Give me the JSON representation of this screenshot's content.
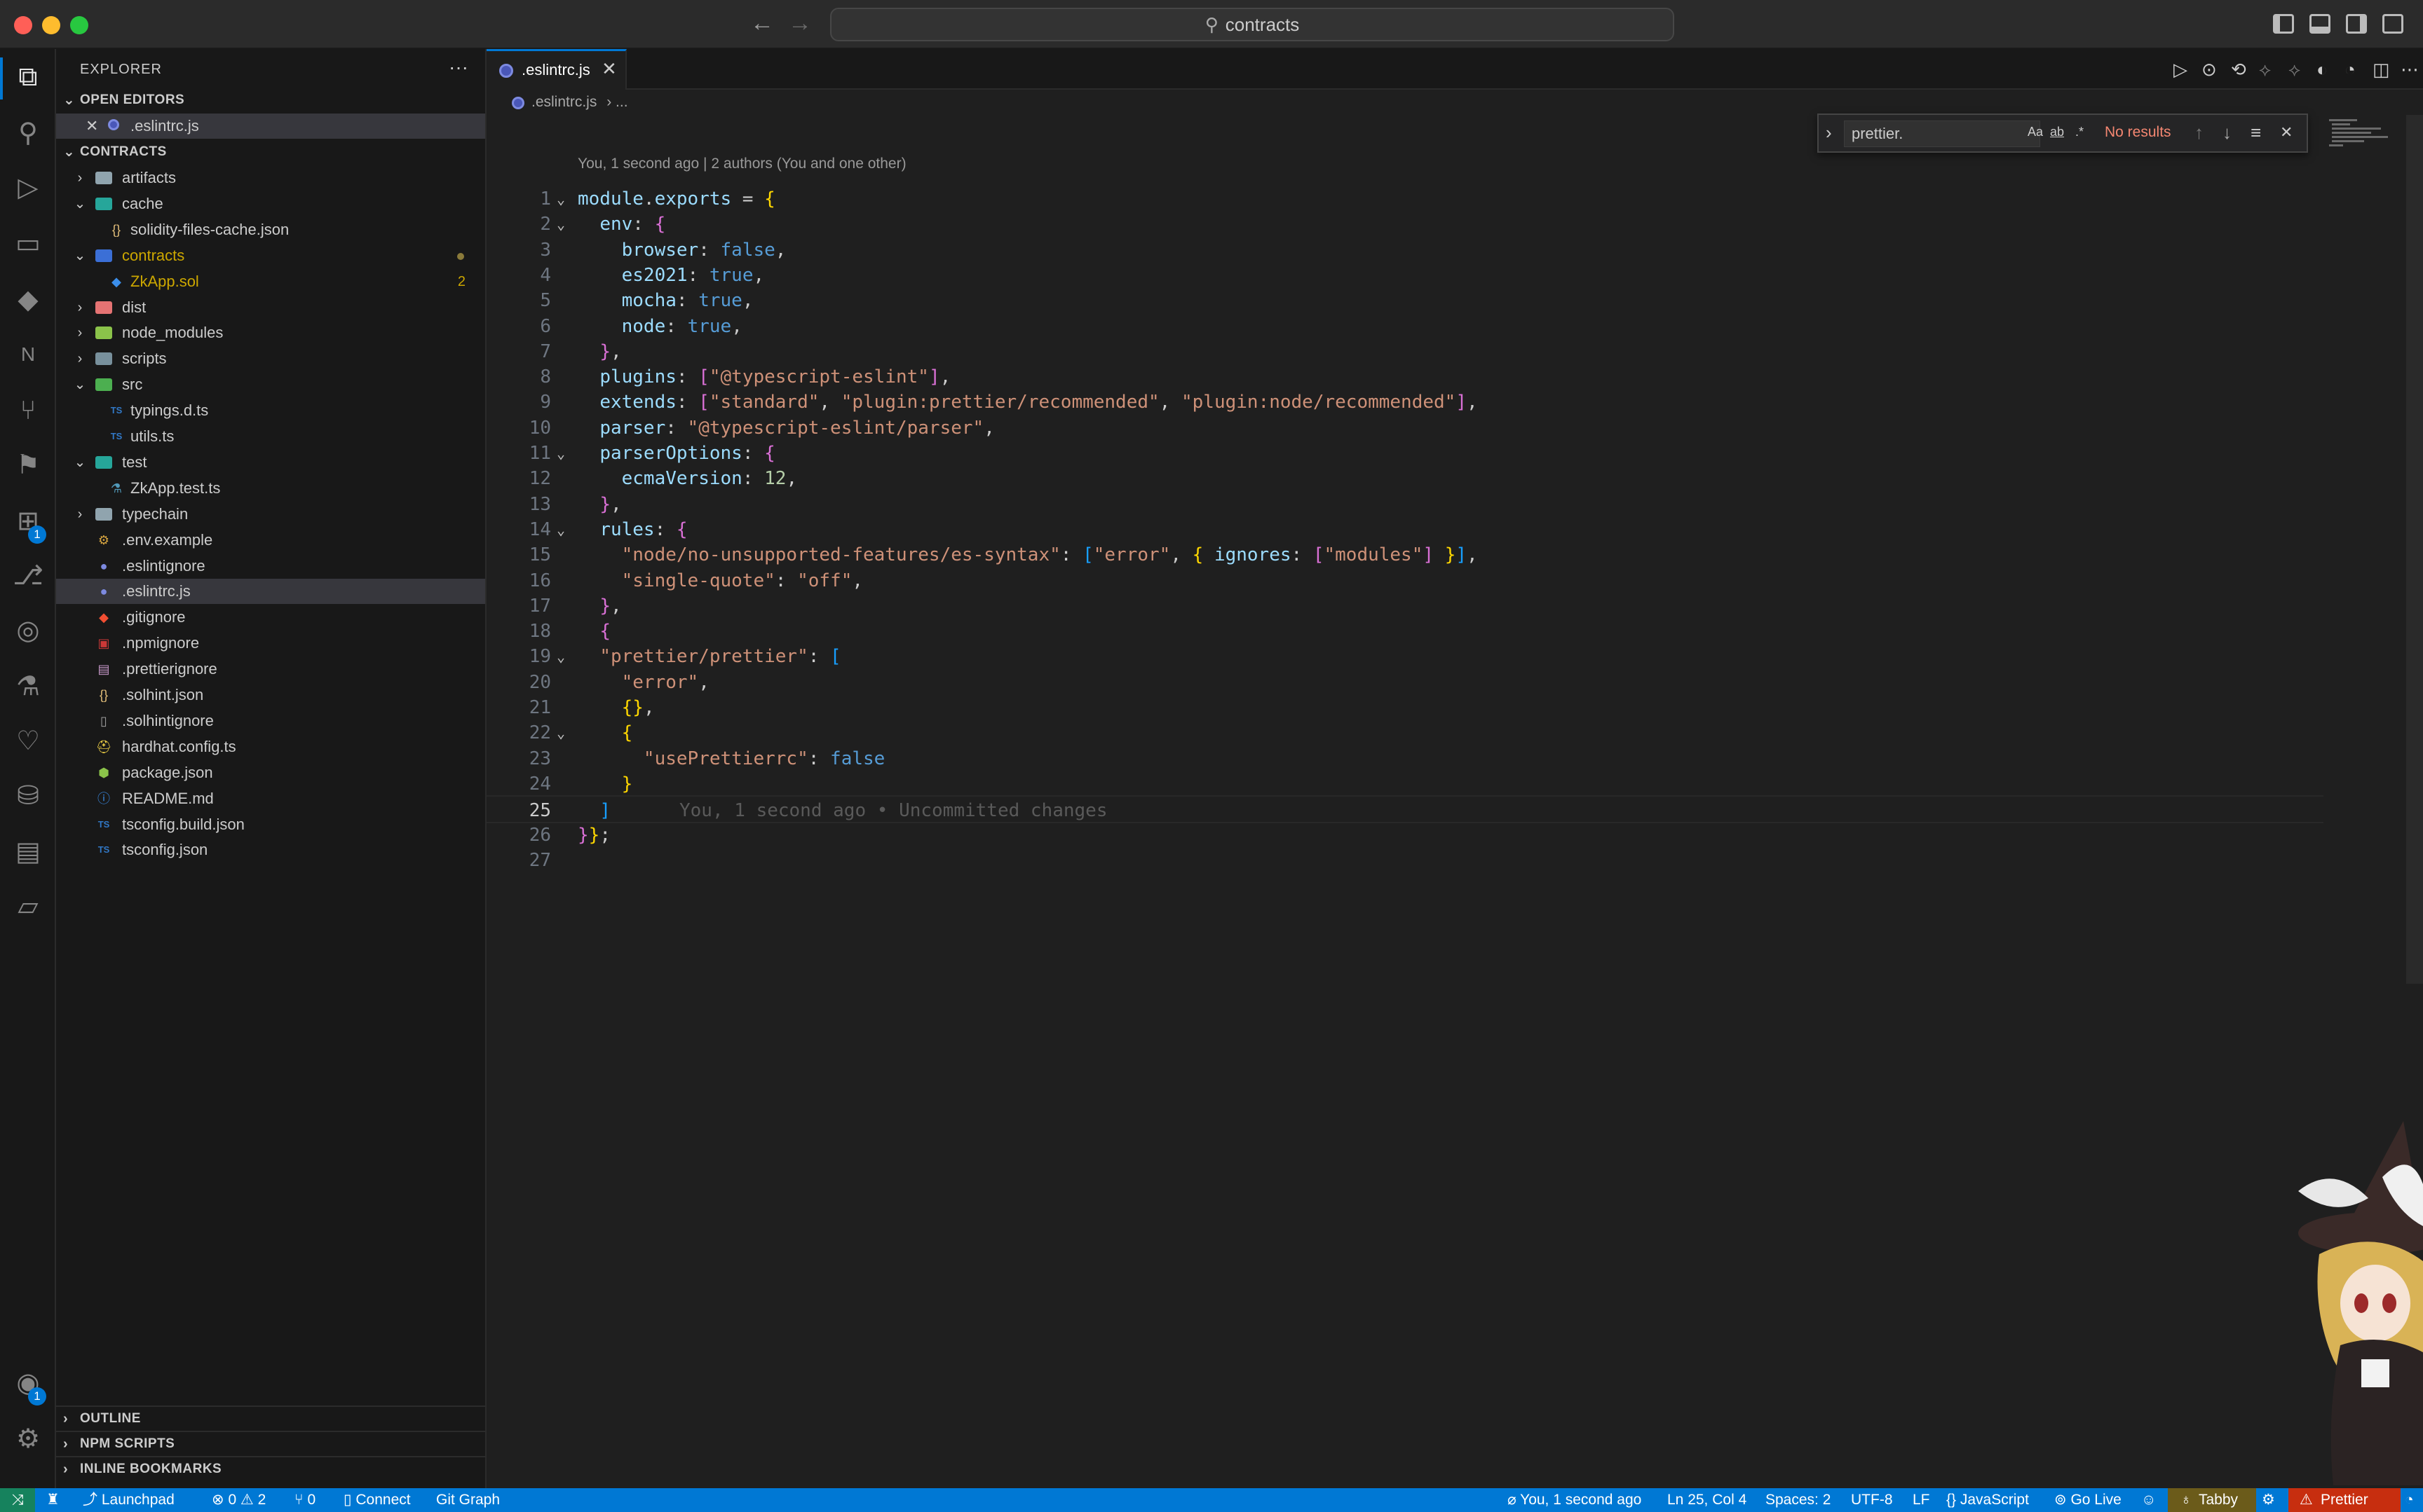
{
  "window": {
    "search_text": "contracts"
  },
  "activity_bar": {
    "extensions_badge": "1",
    "accounts_badge": "1"
  },
  "explorer": {
    "title": "EXPLORER",
    "more": "···",
    "open_editors_label": "OPEN EDITORS",
    "open_editors": [
      ".eslintrc.js"
    ],
    "root_label": "CONTRACTS",
    "tree": [
      {
        "name": "artifacts",
        "kind": "folder",
        "expanded": false,
        "depth": 0
      },
      {
        "name": "cache",
        "kind": "folder",
        "expanded": true,
        "depth": 0
      },
      {
        "name": "solidity-files-cache.json",
        "kind": "json",
        "depth": 1
      },
      {
        "name": "contracts",
        "kind": "folder",
        "expanded": true,
        "depth": 0,
        "modified": true
      },
      {
        "name": "ZkApp.sol",
        "kind": "sol",
        "depth": 1,
        "problems": "2"
      },
      {
        "name": "dist",
        "kind": "folder",
        "expanded": false,
        "depth": 0
      },
      {
        "name": "node_modules",
        "kind": "folder",
        "expanded": false,
        "depth": 0
      },
      {
        "name": "scripts",
        "kind": "folder",
        "expanded": false,
        "depth": 0
      },
      {
        "name": "src",
        "kind": "folder",
        "expanded": true,
        "depth": 0
      },
      {
        "name": "typings.d.ts",
        "kind": "ts",
        "depth": 1
      },
      {
        "name": "utils.ts",
        "kind": "ts",
        "depth": 1
      },
      {
        "name": "test",
        "kind": "folder",
        "expanded": true,
        "depth": 0
      },
      {
        "name": "ZkApp.test.ts",
        "kind": "test",
        "depth": 1
      },
      {
        "name": "typechain",
        "kind": "folder",
        "expanded": false,
        "depth": 0
      },
      {
        "name": ".env.example",
        "kind": "env",
        "depth": 0
      },
      {
        "name": ".eslintignore",
        "kind": "eslint",
        "depth": 0
      },
      {
        "name": ".eslintrc.js",
        "kind": "eslint",
        "depth": 0,
        "selected": true
      },
      {
        "name": ".gitignore",
        "kind": "git",
        "depth": 0
      },
      {
        "name": ".npmignore",
        "kind": "npm",
        "depth": 0
      },
      {
        "name": ".prettierignore",
        "kind": "prettier",
        "depth": 0
      },
      {
        "name": ".solhint.json",
        "kind": "json",
        "depth": 0
      },
      {
        "name": ".solhintignore",
        "kind": "file",
        "depth": 0
      },
      {
        "name": "hardhat.config.ts",
        "kind": "hardhat",
        "depth": 0
      },
      {
        "name": "package.json",
        "kind": "package",
        "depth": 0
      },
      {
        "name": "README.md",
        "kind": "info",
        "depth": 0
      },
      {
        "name": "tsconfig.build.json",
        "kind": "tsconfig",
        "depth": 0
      },
      {
        "name": "tsconfig.json",
        "kind": "tsconfig",
        "depth": 0
      }
    ],
    "bottom_sections": [
      "OUTLINE",
      "NPM SCRIPTS",
      "INLINE BOOKMARKS"
    ]
  },
  "editor": {
    "tab_label": ".eslintrc.js",
    "breadcrumb_file": ".eslintrc.js",
    "breadcrumb_rest": "› ...",
    "codelens": "You, 1 second ago | 2 authors (You and one other)",
    "current_line": 25,
    "blame": "You, 1 second ago • Uncommitted changes",
    "lines": [
      "module.exports = {",
      "  env: {",
      "    browser: false,",
      "    es2021: true,",
      "    mocha: true,",
      "    node: true,",
      "  },",
      "  plugins: [\"@typescript-eslint\"],",
      "  extends: [\"standard\", \"plugin:prettier/recommended\", \"plugin:node/recommended\"],",
      "  parser: \"@typescript-eslint/parser\",",
      "  parserOptions: {",
      "    ecmaVersion: 12,",
      "  },",
      "  rules: {",
      "    \"node/no-unsupported-features/es-syntax\": [\"error\", { ignores: [\"modules\"] }],",
      "    \"single-quote\": \"off\",",
      "  },",
      "  {",
      "  \"prettier/prettier\": [",
      "    \"error\",",
      "    {},",
      "    {",
      "      \"usePrettierrc\": false",
      "    }",
      "  ]",
      "}};",
      ""
    ]
  },
  "find": {
    "query": "prettier.",
    "result": "No results",
    "opt_case": "Aa",
    "opt_word": "ab",
    "opt_regex": ".*"
  },
  "statusbar": {
    "launchpad": "Launchpad",
    "errors": "0",
    "warnings": "2",
    "ports": "0",
    "connect": "Connect",
    "git_graph": "Git Graph",
    "blame": "You, 1 second ago",
    "position": "Ln 25, Col 4",
    "spaces": "Spaces: 2",
    "encoding": "UTF-8",
    "eol": "LF",
    "language": "JavaScript",
    "golive": "Go Live",
    "tabby": "Tabby",
    "prettier": "Prettier"
  },
  "colors": {
    "accent": "#0078d4",
    "remote": "#16825d",
    "prettier_error": "#c72e0f",
    "find_no_results": "#f48771",
    "problems": "#cca700"
  }
}
